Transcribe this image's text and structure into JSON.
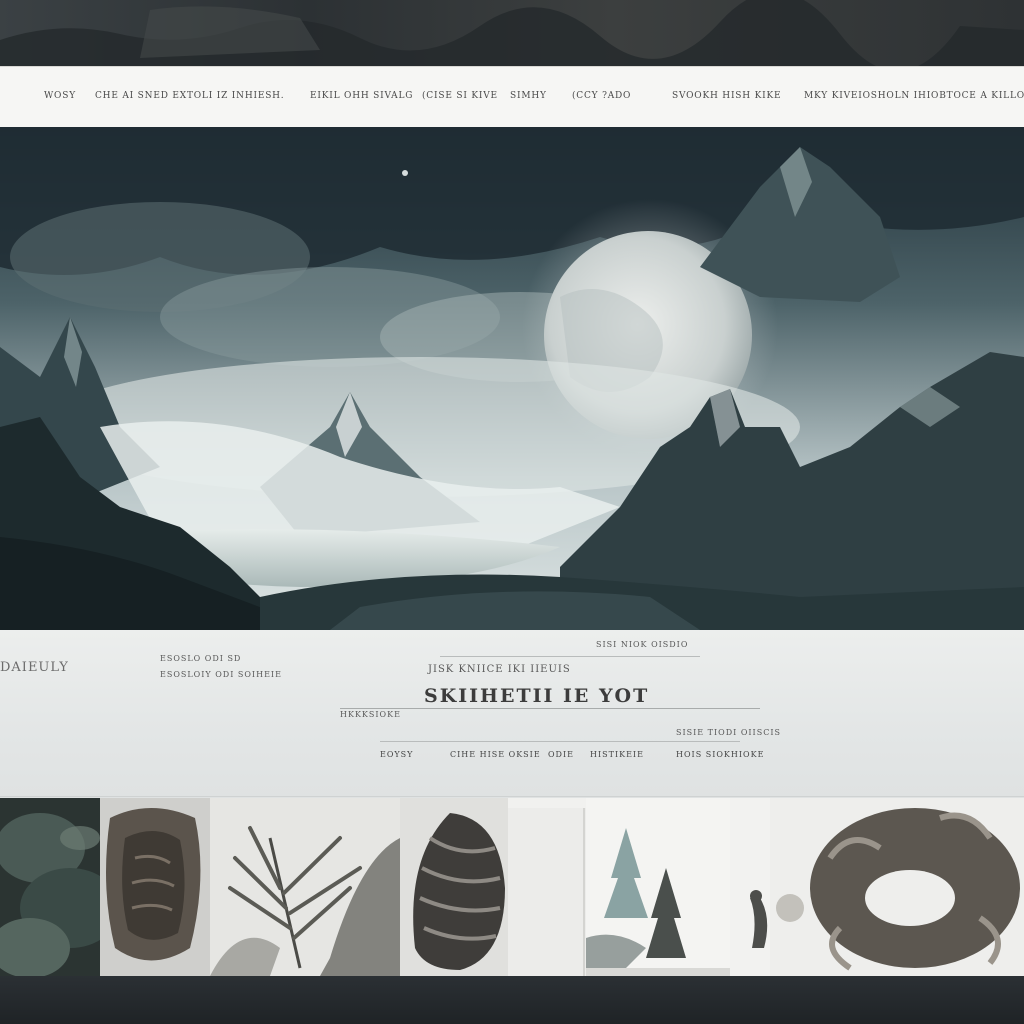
{
  "nav": {
    "items": [
      "WOSY",
      "CHE AI SNED EXTOLI IZ INHIESH.",
      "EIKIL OHH SIVALG",
      "(CISE SI KIVE",
      "SIMHY",
      "(CCY ?ADO",
      "SVOOKH HISH KIKE",
      "MKY KIVEIOSHOLN IHIOBTOCE A KILLOASE"
    ]
  },
  "hero": {
    "image_icon": "moonlit-mountain-landscape"
  },
  "info": {
    "left_label": "DAIEULY",
    "left_meta_1": "ESOSLO ODI SD",
    "left_meta_2": "ESOSLOIY ODI SOIHEIE",
    "top_right_meta": "SISI NIOK OISDIO",
    "kicker": "JISK KNIICE IKI IIEUIS",
    "headline": "SKIIHETII IE YOT",
    "subline": "HKKKSIOKE",
    "subline_right": "SISIE TIODI OIISCIS",
    "footer_1": "EOYSY",
    "footer_2": "CIHE HISE OKSIE",
    "footer_3": "ODIE",
    "footer_4": "HISTIKEIE",
    "footer_5": "HOIS SIOKHIOKE"
  },
  "gallery": {
    "tiles": [
      "mossy-rock-icon",
      "carved-stone-icon",
      "fern-leaves-icon",
      "ribbed-shell-icon",
      "blank-panel-icon",
      "pine-trees-icon",
      "bird-figure-icon",
      "ornate-wreath-icon"
    ]
  }
}
